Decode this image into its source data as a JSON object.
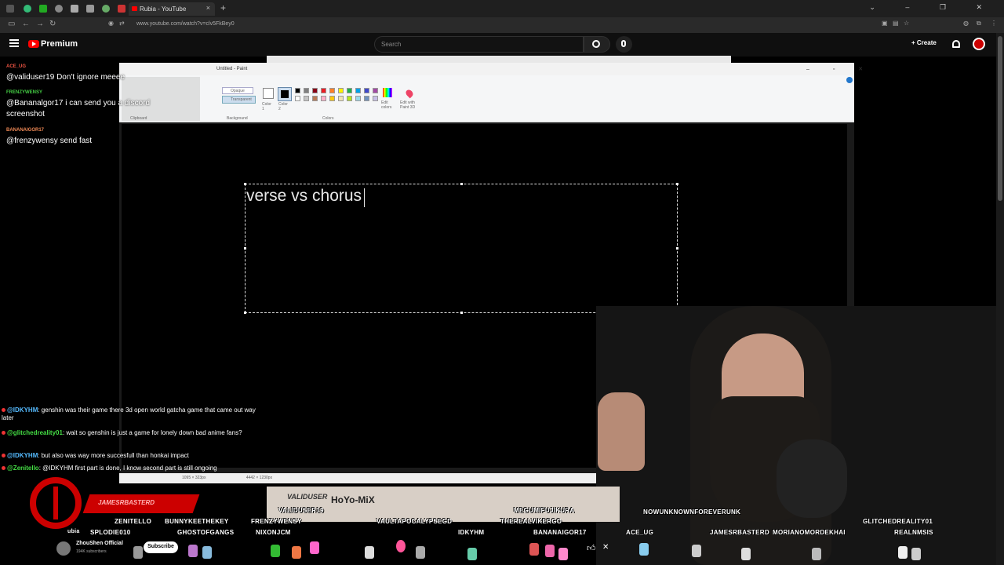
{
  "browser": {
    "tab_title": "Rubia - YouTube",
    "url": "www.youtube.com/watch?v=clv5FkBey0"
  },
  "youtube": {
    "brand": "Premium",
    "search_placeholder": "Search",
    "create_label": "Create"
  },
  "paint": {
    "window_title": "Untitled - Paint",
    "ribbon": {
      "clipboard": "Clipboard",
      "background": "Background",
      "colors": "Colors",
      "opaque": "Opaque",
      "transparent": "Transparent",
      "color1": "Color 1",
      "color2": "Color 2",
      "edit_colors": "Edit colors",
      "edit_paint3d": "Edit with Paint 3D"
    },
    "canvas_text": "verse vs chorus",
    "status_size": "1095 × 323px",
    "status_canvas": "4442 × 1230px"
  },
  "chat_top": [
    {
      "user": "ACE_UG",
      "msg": "@validuser19 Don't ignore meeee"
    },
    {
      "user": "FRENZYWENSY",
      "msg": "@Bananalgor17 i can send you a discord screenshot"
    },
    {
      "user": "BANANAIGOR17",
      "msg": "@frenzywensy send fast"
    }
  ],
  "chat_bottom": [
    {
      "user": "@IDKYHM",
      "msg": ": genshin was their game there 3d open world gatcha game that came out way later"
    },
    {
      "user": "@glitchedreality01",
      "msg": ": wait so genshin is just a game for lonely down bad anime fans?"
    },
    {
      "user": "@IDKYHM",
      "msg": ": but also was way more succesfull than honkai impact"
    },
    {
      "user": "@Zenitello",
      "msg": ": @IDKYHM first part is done, I know second part is still ongoing"
    }
  ],
  "overlay": {
    "banner": "JAMESRBASTERD",
    "hoyo": "HoYo-MiX",
    "valid_logo": "VALIDUSER",
    "names_row1": [
      "ZENITELLO",
      "BUNNYKEETHEKEY",
      "FRENZYWENSY",
      "VALIDUSER19",
      "VAULTAPOCALYPSEGD",
      "THEREALVIKERGO",
      "MEGUMIFUJIKURA",
      "NOWUNKNOWNFOREVERUNK",
      "GLITCHEDREALITY01"
    ],
    "names_row2": [
      "SPLODIE010",
      "GHOSTOFGANGS",
      "NIXONJCM",
      "IDKYHM",
      "BANANAIGOR17",
      "ACE_UG",
      "JAMESRBASTERD",
      "MORIANOMORDEKHAI",
      "REALNMSIS"
    ],
    "channel_name": "ZhouShen Official",
    "channel_subs": "194K subscribers",
    "subscribe_label": "Subscribe",
    "partial_name": "ubia"
  }
}
